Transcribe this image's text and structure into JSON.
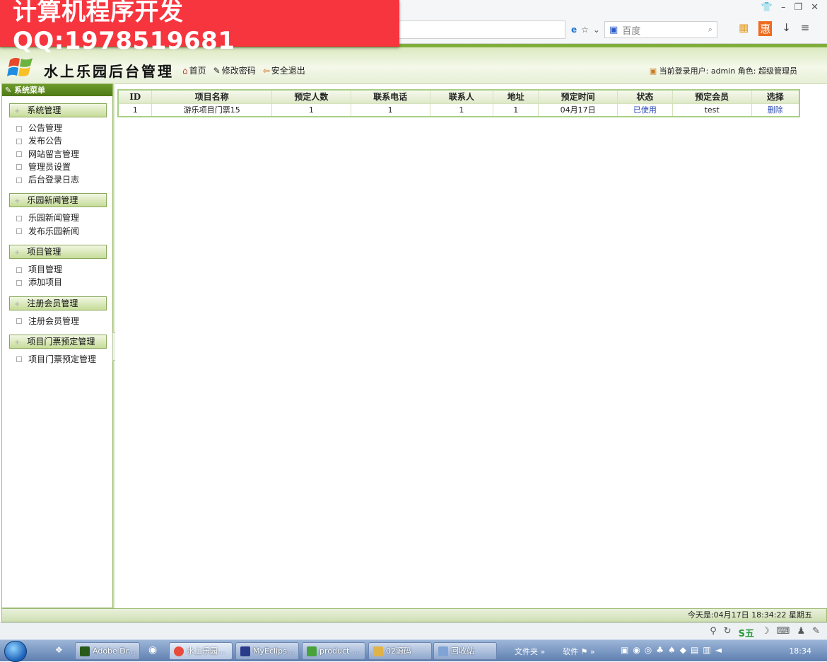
{
  "watermark": "计算机程序开发QQ:1978519681",
  "browser": {
    "search_placeholder": "百度",
    "window_controls": [
      "shirt-icon",
      "minimize-icon",
      "restore-icon",
      "close-icon"
    ]
  },
  "app": {
    "title": "水上乐园后台管理",
    "nav": [
      {
        "label": "首页",
        "icon": "home-icon"
      },
      {
        "label": "修改密码",
        "icon": "edit-icon"
      },
      {
        "label": "安全退出",
        "icon": "exit-icon"
      }
    ],
    "user_info": "当前登录用户: admin 角色: 超级管理员"
  },
  "sidebar": {
    "title": "系统菜单",
    "groups": [
      {
        "label": "系统管理",
        "items": [
          "公告管理",
          "发布公告",
          "网站留言管理",
          "管理员设置",
          "后台登录日志"
        ]
      },
      {
        "label": "乐园新闻管理",
        "items": [
          "乐园新闻管理",
          "发布乐园新闻"
        ]
      },
      {
        "label": "项目管理",
        "items": [
          "项目管理",
          "添加项目"
        ]
      },
      {
        "label": "注册会员管理",
        "items": [
          "注册会员管理"
        ]
      },
      {
        "label": "项目门票预定管理",
        "items": [
          "项目门票预定管理"
        ]
      }
    ]
  },
  "table": {
    "headers": [
      "ID",
      "项目名称",
      "预定人数",
      "联系电话",
      "联系人",
      "地址",
      "预定时间",
      "状态",
      "预定会员",
      "选择"
    ],
    "rows": [
      [
        "1",
        "游乐项目门票15",
        "1",
        "1",
        "1",
        "1",
        "04月17日",
        "已使用",
        "test",
        "删除"
      ]
    ]
  },
  "status_bar": {
    "text": "今天是:04月17日  18:34:22   星期五"
  },
  "side_ball": "66",
  "taskbar": {
    "buttons": [
      {
        "label": "Adobe Dr...",
        "color": "#2a5a1a"
      },
      {
        "label": "水上乐园...",
        "color": "#e84a3c"
      },
      {
        "label": "MyEclips...",
        "color": "#2b3b8c"
      },
      {
        "label": "product ...",
        "color": "#47a23c"
      },
      {
        "label": "02源码",
        "color": "#e0b24a"
      },
      {
        "label": "回收站",
        "color": "#7fa3d4"
      }
    ],
    "tray_labels": [
      "文件夹",
      "软件"
    ],
    "clock": "18:34"
  }
}
